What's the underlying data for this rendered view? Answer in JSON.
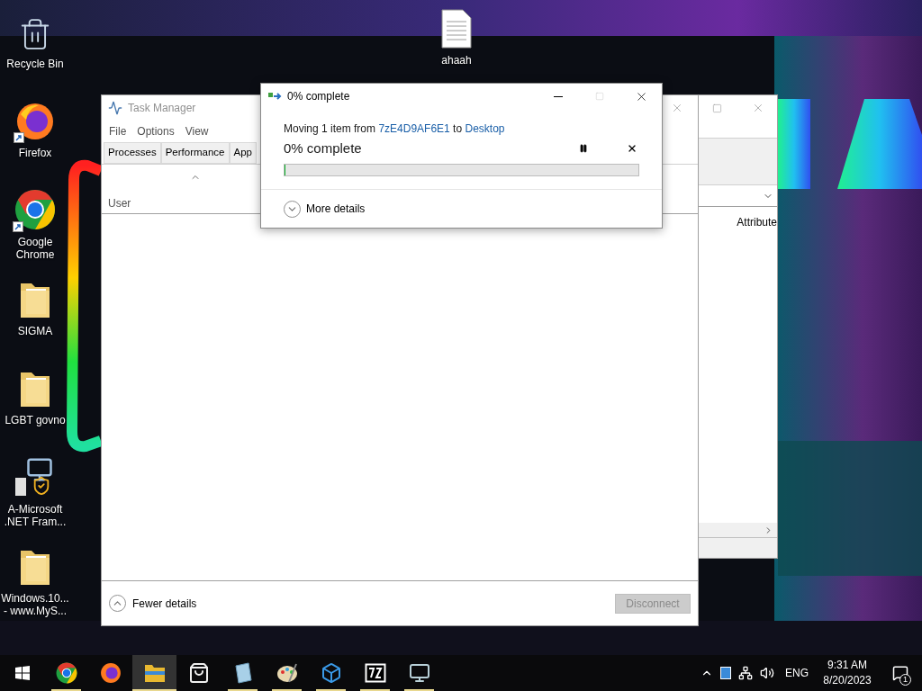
{
  "desktop_icons": [
    {
      "label": "Recycle Bin",
      "kind": "recycle",
      "shortcut": false
    },
    {
      "label": "Firefox",
      "kind": "firefox",
      "shortcut": true
    },
    {
      "label": "Google Chrome",
      "kind": "chrome",
      "shortcut": true
    },
    {
      "label": "SIGMA",
      "kind": "folder",
      "shortcut": false
    },
    {
      "label": "LGBT govno",
      "kind": "folder",
      "shortcut": false
    },
    {
      "label": "A-Microsoft .NET Fram...",
      "kind": "installer",
      "shortcut": false
    },
    {
      "label": "Windows.10... - www.MyS...",
      "kind": "folder",
      "shortcut": false
    }
  ],
  "desktop_file": {
    "label": "ahaah",
    "kind": "document"
  },
  "back_window": {
    "column": "Attribute"
  },
  "task_manager": {
    "title": "Task Manager",
    "menu": [
      "File",
      "Options",
      "View"
    ],
    "tabs": [
      {
        "label": "Processes",
        "selected": false
      },
      {
        "label": "Performance",
        "selected": false
      },
      {
        "label": "App",
        "selected": false
      }
    ],
    "column": "User",
    "footer_toggle": "Fewer details",
    "disconnect": {
      "label": "Disconnect",
      "disabled": true
    }
  },
  "dialog": {
    "title": "0% complete",
    "message": {
      "prefix": "Moving 1 item from",
      "source": "7zE4D9AF6E1",
      "middle": "to",
      "destination": "Desktop"
    },
    "status": "0% complete",
    "progress": {
      "level": 0
    },
    "maximize_disabled": true,
    "details_toggle": "More details"
  },
  "taskbar": {
    "apps": [
      {
        "kind": "chrome",
        "running": true,
        "selected": false
      },
      {
        "kind": "firefox",
        "running": false,
        "selected": false
      },
      {
        "kind": "explorer",
        "running": true,
        "selected": true
      },
      {
        "kind": "store",
        "running": false,
        "selected": false
      },
      {
        "kind": "notepad",
        "running": true,
        "selected": false
      },
      {
        "kind": "paint",
        "running": true,
        "selected": false
      },
      {
        "kind": "cubes",
        "running": true,
        "selected": false
      },
      {
        "kind": "archive",
        "running": true,
        "selected": false
      },
      {
        "kind": "monitor",
        "running": true,
        "selected": false
      }
    ],
    "tray": {
      "language": "ENG",
      "time": "9:31 AM",
      "date": "8/20/2023",
      "notifications": "1"
    }
  }
}
